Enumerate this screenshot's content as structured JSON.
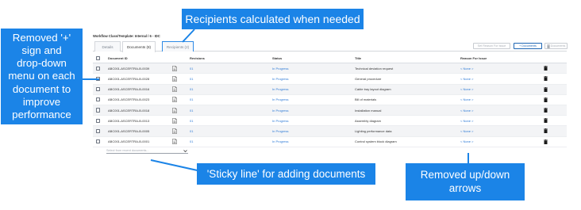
{
  "workflow_title": "Workflow Class/Template: Internal / 6 - IDC",
  "tabs": [
    {
      "label": "Details",
      "active": false
    },
    {
      "label": "Documents (8)",
      "active": true
    },
    {
      "label": "Recipients (2)",
      "active": false
    }
  ],
  "toolbar": {
    "reason_label": "Set Reason For Issue",
    "add_documents_label": "+ Documents",
    "delete_documents_label": "Documents"
  },
  "columns": {
    "document_id": "Document ID",
    "revisions": "Revisions",
    "status": "Status",
    "title": "Title",
    "reason": "Reason For Issue"
  },
  "rows": [
    {
      "document_id": "ABC001-ASCERTRA-B-0039",
      "revision": "01",
      "status": "In Progress",
      "title": "Technical deviation request",
      "reason": "< None >"
    },
    {
      "document_id": "ABC001-ASCERTRA-B-0028",
      "revision": "01",
      "status": "In Progress",
      "title": "General procedure",
      "reason": "< None >"
    },
    {
      "document_id": "ABC001-ASCERTRA-B-0016",
      "revision": "01",
      "status": "In Progress",
      "title": "Cable tray layout diagram",
      "reason": "< None >"
    },
    {
      "document_id": "ABC001-ASCERTRA-B-0023",
      "revision": "01",
      "status": "In Progress",
      "title": "Bill of materials",
      "reason": "< None >"
    },
    {
      "document_id": "ABC001-ASCERTRA-B-0018",
      "revision": "01",
      "status": "In Progress",
      "title": "Installation manual",
      "reason": "< None >"
    },
    {
      "document_id": "ABC001-ASCERTRA-B-0013",
      "revision": "01",
      "status": "In Progress",
      "title": "Assembly diagram",
      "reason": "< None >"
    },
    {
      "document_id": "ABC001-ASCERTRA-B-0005",
      "revision": "01",
      "status": "In Progress",
      "title": "Lighting performance data",
      "reason": "< None >"
    },
    {
      "document_id": "ABC001-ASCERTRA-B-0001",
      "revision": "01",
      "status": "In Progress",
      "title": "Control system block diagram",
      "reason": "< None >"
    }
  ],
  "sticky_line_placeholder": "Select from recent documents...",
  "callouts": {
    "recipients": "Recipients calculated when needed",
    "removed_plus": "Removed '+'\nsign and\ndrop-down\nmenu on each\ndocument to\nimprove\nperformance",
    "sticky_line": "'Sticky line' for adding documents",
    "removed_arrows": "Removed up/down\narrows"
  },
  "colors": {
    "callout_blue": "#1b84e7",
    "link_blue": "#2f7bd6",
    "row_stripe": "#f3f4f6"
  },
  "icons": {
    "file": "file-icon",
    "trash": "trash-icon",
    "select_chevron": "chevron-down-icon"
  }
}
